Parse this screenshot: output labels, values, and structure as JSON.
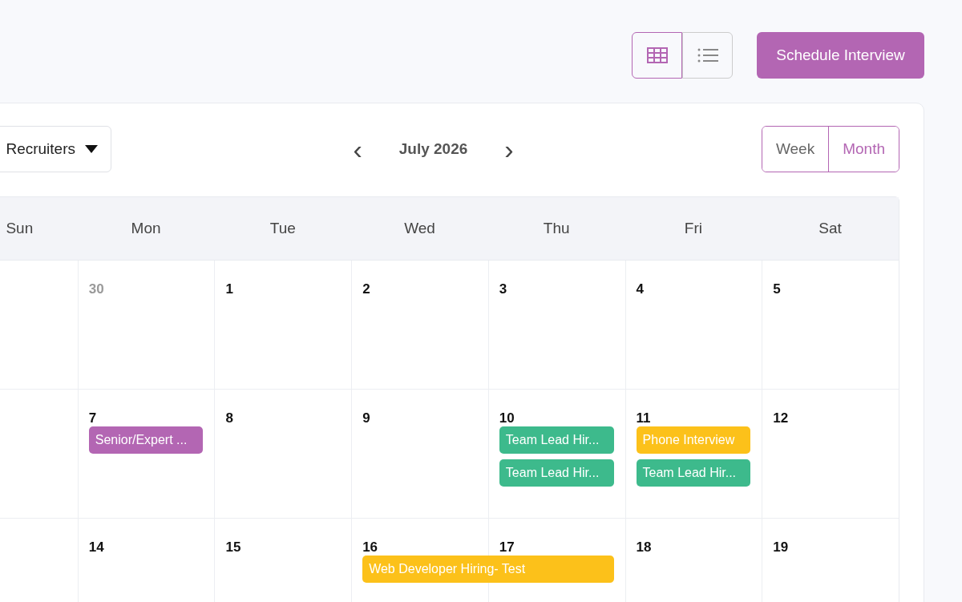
{
  "toolbar": {
    "views": [
      {
        "kind": "grid",
        "selected": true
      },
      {
        "kind": "list",
        "selected": false
      }
    ],
    "primary_button": "Schedule Interview"
  },
  "calendar": {
    "filter": {
      "value": "Recruiters"
    },
    "prev": "‹",
    "title": "July 2026",
    "next": "›",
    "modes": [
      {
        "label": "Week",
        "selected": false
      },
      {
        "label": "Month",
        "selected": true
      }
    ],
    "weekdays": [
      "Sun",
      "Mon",
      "Tue",
      "Wed",
      "Thu",
      "Fri",
      "Sat"
    ],
    "weeks": [
      {
        "days": [
          {
            "day": "30",
            "outside": true
          },
          {
            "day": "1",
            "outside": false
          },
          {
            "day": "2",
            "outside": false
          },
          {
            "day": "3",
            "outside": false
          },
          {
            "day": "4",
            "outside": false
          },
          {
            "day": "5",
            "outside": false
          }
        ]
      },
      {
        "days": [
          {
            "day": "7",
            "outside": false,
            "events": [
              {
                "title": "Senior/Expert ...",
                "color": "#b366b3",
                "kind": "single"
              }
            ]
          },
          {
            "day": "8",
            "outside": false
          },
          {
            "day": "9",
            "outside": false
          },
          {
            "day": "10",
            "outside": false,
            "events": [
              {
                "title": "Team Lead Hir...",
                "color": "#3dba8c",
                "kind": "single"
              },
              {
                "title": "Team Lead Hir...",
                "color": "#3dba8c",
                "kind": "single"
              }
            ]
          },
          {
            "day": "11",
            "outside": false,
            "events": [
              {
                "title": "Phone Interview",
                "color": "#fcc11a",
                "kind": "single"
              },
              {
                "title": "Team Lead Hir...",
                "color": "#3dba8c",
                "kind": "single"
              }
            ]
          },
          {
            "day": "12",
            "outside": false
          }
        ]
      },
      {
        "days": [
          {
            "day": "14",
            "outside": false
          },
          {
            "day": "15",
            "outside": false
          },
          {
            "day": "16",
            "outside": false,
            "events": [
              {
                "title": "Web Developer Hiring- Test",
                "color": "#fcc11a",
                "kind": "double"
              }
            ]
          },
          {
            "day": "17",
            "outside": false
          },
          {
            "day": "18",
            "outside": false
          },
          {
            "day": "19",
            "outside": false
          }
        ]
      }
    ]
  }
}
